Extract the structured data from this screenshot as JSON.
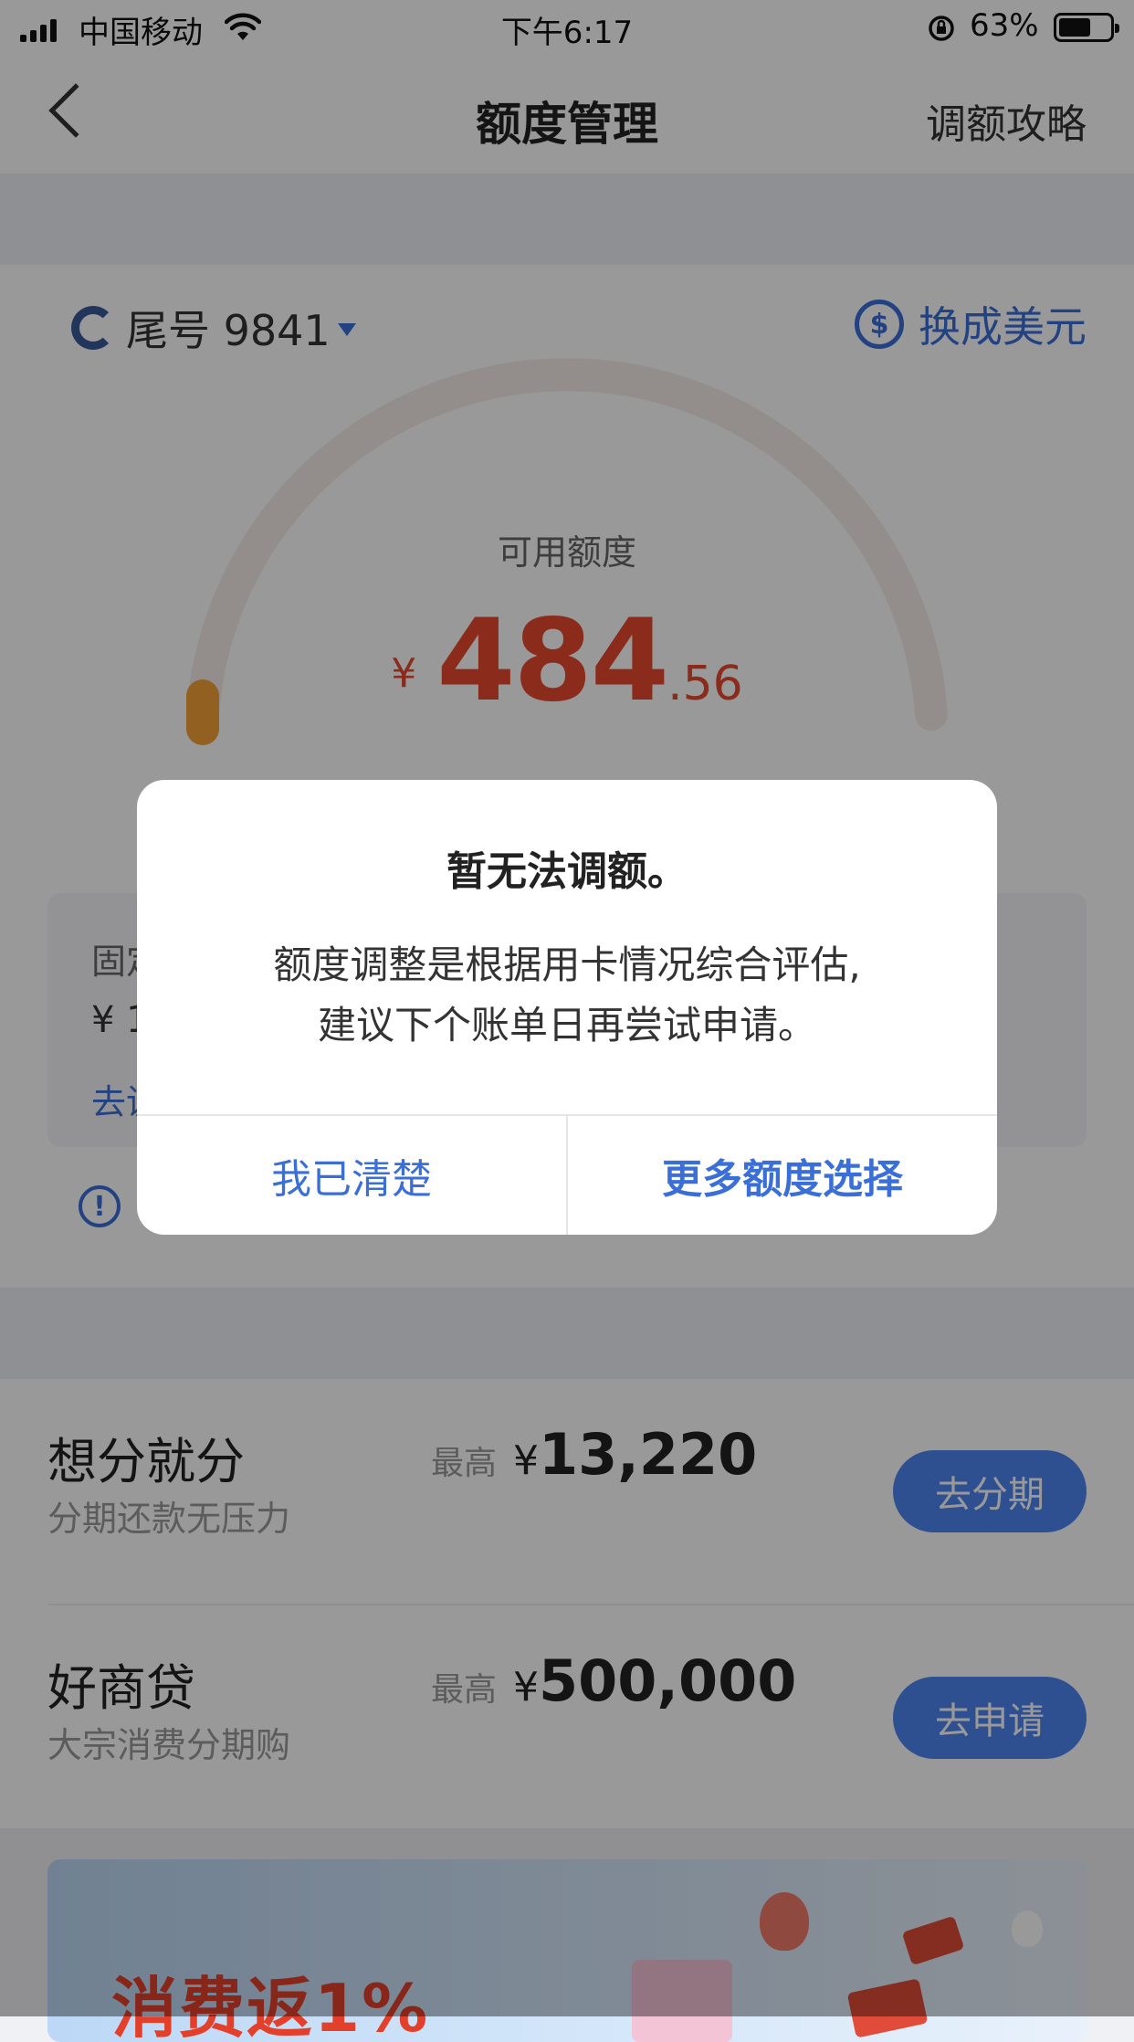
{
  "status_bar": {
    "carrier": "中国移动",
    "time": "下午6:17",
    "battery": "63%",
    "battery_level": 0.63
  },
  "nav": {
    "title": "额度管理",
    "right_link": "调额攻略"
  },
  "card": {
    "tail_number": "尾号 9841",
    "convert_link": "换成美元",
    "available_label": "可用额度",
    "currency": "¥",
    "amount_int": "484",
    "amount_dec": ".56",
    "fixed_label": "固定",
    "fixed_amount": "¥ 1",
    "fixed_link": "去调"
  },
  "products": [
    {
      "name": "想分就分",
      "sub": "分期还款无压力",
      "max_label": "最高",
      "yen": "¥",
      "max_value": "13,220",
      "button": "去分期"
    },
    {
      "name": "好商贷",
      "sub": "大宗消费分期购",
      "max_label": "最高",
      "yen": "¥",
      "max_value": "500,000",
      "button": "去申请"
    }
  ],
  "banner": {
    "text": "消费返1%"
  },
  "dialog": {
    "title": "暂无法调额。",
    "message_line1": "额度调整是根据用卡情况综合评估,",
    "message_line2": "建议下个账单日再尝试申请。",
    "cancel_label": "我已清楚",
    "confirm_label": "更多额度选择"
  },
  "colors": {
    "accent": "#3b6fd8",
    "amount": "#e8482d",
    "button": "#4f86f0",
    "gauge_start": "#f3a23a"
  }
}
